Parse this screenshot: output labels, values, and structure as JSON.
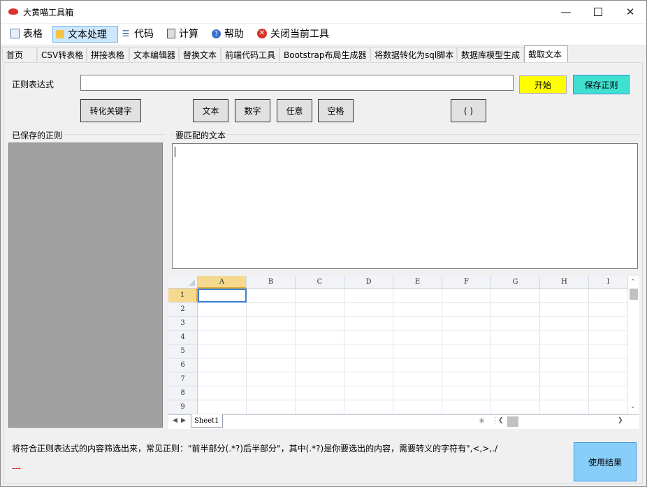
{
  "window": {
    "title": "大黄喵工具箱"
  },
  "menu": [
    {
      "label": "表格",
      "icon": "table-icon"
    },
    {
      "label": "文本处理",
      "icon": "edit-icon"
    },
    {
      "label": "代码",
      "icon": "list-icon"
    },
    {
      "label": "计算",
      "icon": "calculator-icon"
    },
    {
      "label": "帮助",
      "icon": "help-icon"
    },
    {
      "label": "关闭当前工具",
      "icon": "close-red-icon"
    }
  ],
  "tabs": [
    "首页",
    "CSV转表格",
    "拼接表格",
    "文本编辑器",
    "替换文本",
    "前端代码工具",
    "Bootstrap布局生成器",
    "将数据转化为sql脚本",
    "数据库模型生成",
    "截取文本"
  ],
  "active_tab": "截取文本",
  "regex": {
    "label": "正则表达式",
    "value": "",
    "start_label": "开始",
    "save_label": "保存正则",
    "start_color": "#ffff00",
    "save_color": "#40e0d0"
  },
  "buttons": {
    "convert_keyword": "转化关键字",
    "text": "文本",
    "digit": "数字",
    "any": "任意",
    "space": "空格",
    "group": "( )"
  },
  "saved": {
    "title": "已保存的正则"
  },
  "match": {
    "title": "要匹配的文本",
    "value": ""
  },
  "sheet": {
    "columns": [
      "A",
      "B",
      "C",
      "D",
      "E",
      "F",
      "G",
      "H",
      "I"
    ],
    "rows": [
      "1",
      "2",
      "3",
      "4",
      "5",
      "6",
      "7",
      "8",
      "9"
    ],
    "active_cell": "A1",
    "tab_name": "Sheet1"
  },
  "footer": {
    "hint": "将符合正则表达式的内容筛选出来，常见正则：\"前半部分(.*?)后半部分\"，其中(.*?)是你要选出的内容，需要转义的字符有\",<,>,./",
    "status": "---",
    "use_result": "使用结果",
    "use_result_color": "#87cefa"
  }
}
